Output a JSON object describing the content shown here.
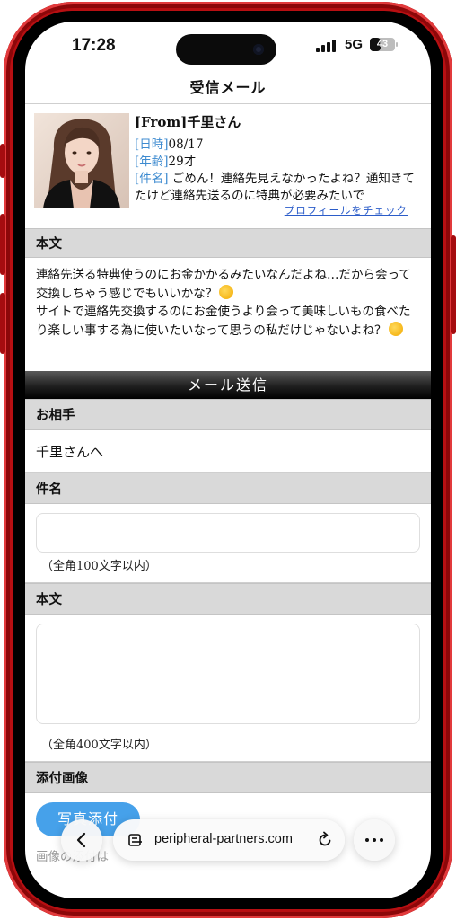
{
  "status_bar": {
    "time": "17:28",
    "network": "5G",
    "battery": "43",
    "battery_level": 0.43
  },
  "header": {
    "title": "受信メール"
  },
  "profile": {
    "from": "[From]千里さん",
    "date_label": "[日時]",
    "date": "08/17",
    "age_label": "[年齢]",
    "age": "29才",
    "subject_label": "[件名]",
    "subject": "ごめん！連絡先見えなかったよね？通知きてたけど連絡先送るのに特典が必要みたいで",
    "profile_link": "プロフィールをチェック"
  },
  "message": {
    "section_title": "本文",
    "line1": "連絡先送る特典使うのにお金かかるみたいなんだよね…だから会って交換しちゃう感じでもいいかな？",
    "line2": "サイトで連絡先交換するのにお金使うより会って美味しいもの食べたり楽しい事する為に使いたいなって思うの私だけじゃないよね？"
  },
  "reply_form": {
    "bar_title": "メール送信",
    "recipient_label": "お相手",
    "recipient": "千里さんへ",
    "subject_label": "件名",
    "subject_value": "",
    "subject_hint": "（全角100文字以内）",
    "body_label": "本文",
    "body_value": "",
    "body_hint": "（全角400文字以内）",
    "attach_label": "添付画像",
    "attach_button": "写真添付",
    "attach_note": "画像の添付は"
  },
  "browser": {
    "url": "peripheral-partners.com"
  },
  "colors": {
    "frame": "#b80f12",
    "label_blue": "#3e8bd0",
    "attach_button": "#46a1ea",
    "link": "#2b5cc9"
  },
  "icons": [
    "back-chevron-icon",
    "tabs-icon",
    "reload-icon",
    "more-icon"
  ]
}
